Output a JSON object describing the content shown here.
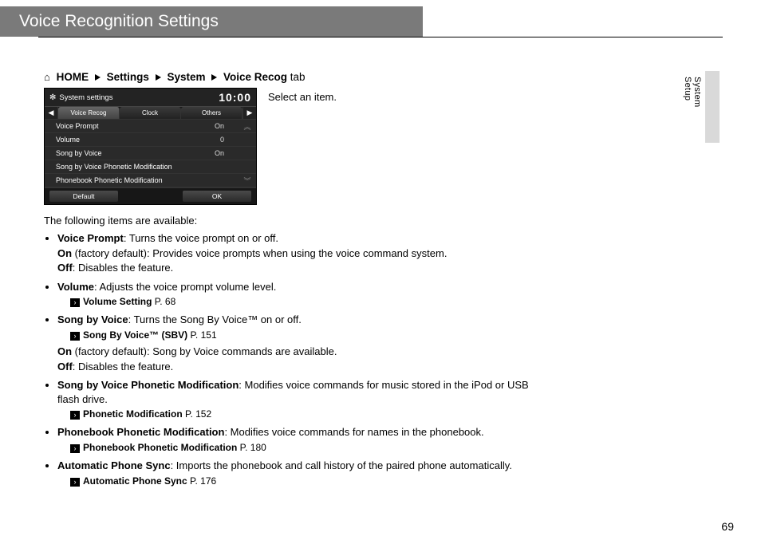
{
  "title": "Voice Recognition Settings",
  "section_label": "System Setup",
  "breadcrumb": {
    "home": "HOME",
    "settings": "Settings",
    "system": "System",
    "tab": "Voice Recog",
    "suffix": " tab"
  },
  "instruction": "Select an item.",
  "screenshot": {
    "header": "System settings",
    "clock": "10:00",
    "tabs": {
      "left": "Voice Recog",
      "mid": "Clock",
      "right": "Others"
    },
    "rows": [
      {
        "label": "Voice Prompt",
        "value": "On"
      },
      {
        "label": "Volume",
        "value": "0"
      },
      {
        "label": "Song by Voice",
        "value": "On"
      },
      {
        "label": "Song by Voice Phonetic Modification",
        "value": ""
      },
      {
        "label": "Phonebook Phonetic Modification",
        "value": ""
      }
    ],
    "btn_default": "Default",
    "btn_ok": "OK"
  },
  "available_intro": "The following items are available:",
  "items": {
    "voice_prompt": {
      "label": "Voice Prompt",
      "desc": ": Turns the voice prompt on or off.",
      "on_label": "On",
      "on_desc": " (factory default): Provides voice prompts when using the voice command system.",
      "off_label": "Off",
      "off_desc": ": Disables the feature."
    },
    "volume": {
      "label": "Volume",
      "desc": ": Adjusts the voice prompt volume level.",
      "xref": "Volume Setting",
      "xref_page": " P. 68"
    },
    "sbv": {
      "label": "Song by Voice",
      "desc": ": Turns the Song By Voice™ on or off.",
      "xref": "Song By Voice™ (SBV)",
      "xref_page": " P. 151",
      "on_label": "On",
      "on_desc": " (factory default): Song by Voice commands are available.",
      "off_label": "Off",
      "off_desc": ": Disables the feature."
    },
    "sbvphon": {
      "label": "Song by Voice Phonetic Modification",
      "desc": ": Modifies voice commands for music stored in the iPod or USB flash drive.",
      "xref": "Phonetic Modification",
      "xref_page": " P. 152"
    },
    "pbphon": {
      "label": "Phonebook Phonetic Modification",
      "desc": ": Modifies voice commands for names in the phonebook.",
      "xref": "Phonebook Phonetic Modification",
      "xref_page": " P. 180"
    },
    "autosync": {
      "label": "Automatic Phone Sync",
      "desc": ": Imports the phonebook and call history of the paired phone automatically.",
      "xref": "Automatic Phone Sync",
      "xref_page": " P. 176"
    }
  },
  "page_number": "69"
}
